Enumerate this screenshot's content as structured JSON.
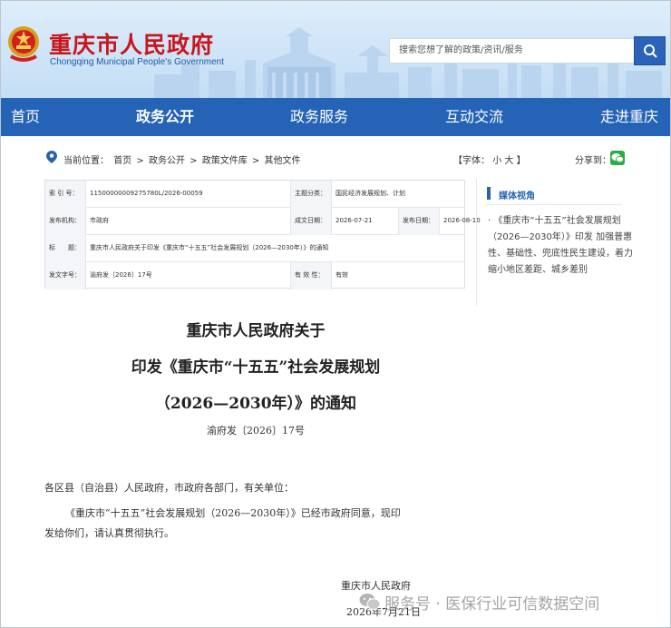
{
  "header": {
    "site_title": "重庆市人民政府",
    "site_subtitle": "Chongqing Municipal People's Government",
    "search_placeholder": "搜索您想了解的政策/资讯/服务"
  },
  "nav": {
    "items": [
      {
        "label": "首页",
        "active": false
      },
      {
        "label": "政务公开",
        "active": true
      },
      {
        "label": "政务服务",
        "active": false
      },
      {
        "label": "互动交流",
        "active": false
      },
      {
        "label": "走进重庆",
        "active": false
      }
    ]
  },
  "breadcrumb": {
    "prefix": "当前位置：",
    "items": [
      "首页",
      "政务公开",
      "政策文件库",
      "其他文件"
    ],
    "separator": ">"
  },
  "font_size": {
    "open": "【字体：",
    "small": "小",
    "large": "大",
    "close": "】"
  },
  "share": {
    "label": "分享到："
  },
  "meta": {
    "index_label": "索 引 号：",
    "index_value": "11500000009275780L/2026-00059",
    "category_label": "主题分类：",
    "category_value": "国民经济发展规划、计划",
    "issuer_label": "发布机构：",
    "issuer_value": "市政府",
    "date_label": "成文日期：",
    "date_value": "2026-07-21",
    "publish_label": "发布日期：",
    "publish_value": "2026-08-10",
    "title_label": "标　　题：",
    "title_value": "重庆市人民政府关于印发《重庆市“十五五”社会发展规划（2026—2030年）》的通知",
    "doc_no_label": "发文字号：",
    "doc_no_value": "渝府发〔2026〕17号",
    "validity_label": "有 效 性：",
    "validity_value": "有效"
  },
  "document": {
    "title_lines": [
      "重庆市人民政府关于",
      "印发《重庆市“十五五”社会发展规划",
      "（2026—2030年）》的通知"
    ],
    "number": "渝府发〔2026〕17号",
    "salutation": "各区县（自治县）人民政府，市政府各部门，有关单位：",
    "body_line1": "《重庆市“十五五”社会发展规划（2026—2030年）》已经市政府同意，现印",
    "body_line2": "发给你们，请认真贯彻执行。",
    "signature": "重庆市人民政府",
    "sign_date": "2026年7月21日"
  },
  "sidebar": {
    "title": "媒体视角",
    "items": [
      "《重庆市“十五五”社会发展规划（2026—2030年）》印发 加强普惠性、基础性、兜底性民生建设，着力缩小地区差距、城乡差别"
    ]
  },
  "watermark": {
    "text": "服务号 · 医保行业可信数据空间"
  },
  "colors": {
    "brand_red": "#c8161d",
    "nav_blue": "#2463b6",
    "wechat_green": "#2aae3f"
  }
}
